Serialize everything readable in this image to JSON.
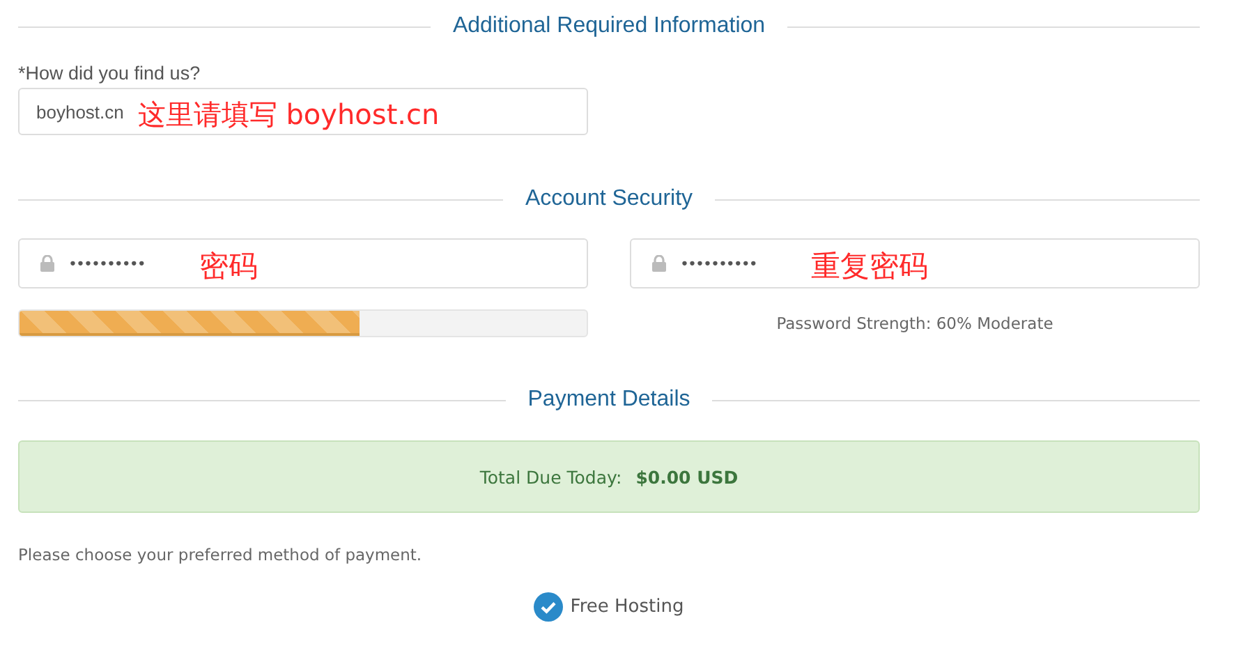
{
  "sections": [
    {
      "title": "Additional Required Information"
    },
    {
      "title": "Account Security"
    },
    {
      "title": "Payment Details"
    }
  ],
  "referral": {
    "label": "*How did you find us?",
    "value": "boyhost.cn",
    "annotation": "这里请填写 boyhost.cn"
  },
  "password": {
    "value": "••••••••••",
    "annotation": "密码"
  },
  "confirm_password": {
    "value": "••••••••••",
    "annotation": "重复密码"
  },
  "strength": {
    "level": 0.6,
    "reading": "Password Strength: 60% Moderate"
  },
  "total": {
    "label": "Total Due Today:",
    "amount": "$0.00 USD"
  },
  "payment_hint": "Please choose your preferred method of payment.",
  "payment_methods": [
    {
      "label": "Free Hosting",
      "selected": true
    }
  ]
}
